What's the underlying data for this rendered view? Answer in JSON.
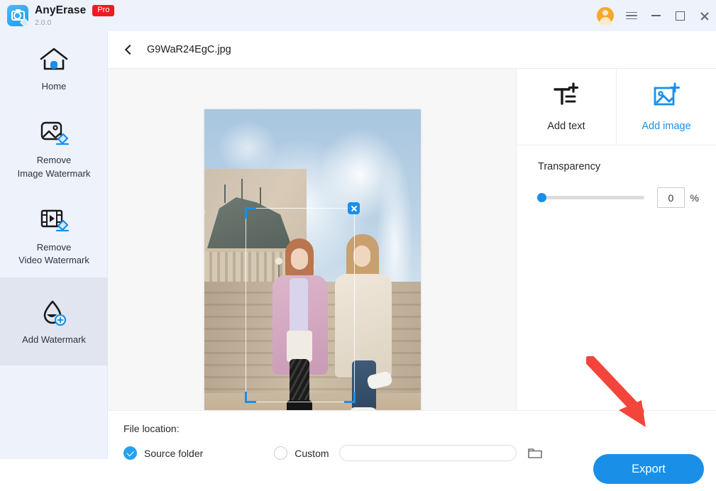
{
  "app": {
    "brand": "AnyErase",
    "badge": "Pro",
    "version": "2.0.0",
    "logo_icon": "camera-eraser-icon"
  },
  "titlebar": {
    "account_icon": "user-avatar-icon",
    "menu_icon": "hamburger-menu-icon",
    "minimize_icon": "minimize-icon",
    "maximize_icon": "maximize-icon",
    "close_icon": "close-icon"
  },
  "sidebar": {
    "items": [
      {
        "label": "Home",
        "icon": "home-icon",
        "active": false
      },
      {
        "label": "Remove\nImage Watermark",
        "line1": "Remove",
        "line2": "Image Watermark",
        "icon": "image-eraser-icon",
        "active": false
      },
      {
        "label": "Remove\nVideo Watermark",
        "line1": "Remove",
        "line2": "Video Watermark",
        "icon": "video-eraser-icon",
        "active": false
      },
      {
        "label": "Add Watermark",
        "line1": "Add Watermark",
        "line2": "",
        "icon": "water-drop-plus-icon",
        "active": true
      }
    ]
  },
  "filebar": {
    "back_icon": "chevron-left-icon",
    "filename": "G9WaR24EgC.jpg"
  },
  "canvas": {
    "image_alt": "two women standing on palace stairs",
    "selection": {
      "delete_icon": "close-icon",
      "handles": [
        "top-left",
        "top-right",
        "bottom-left",
        "bottom-right"
      ]
    }
  },
  "panel": {
    "tabs": [
      {
        "label": "Add text",
        "icon": "add-text-icon",
        "active": false
      },
      {
        "label": "Add image",
        "icon": "add-image-icon",
        "active": true
      }
    ],
    "transparency": {
      "label": "Transparency",
      "value": "0",
      "unit": "%",
      "min": 0,
      "max": 100
    }
  },
  "footer": {
    "file_location_label": "File location:",
    "options": [
      {
        "label": "Source folder",
        "selected": true
      },
      {
        "label": "Custom",
        "selected": false
      }
    ],
    "custom_path_value": "",
    "custom_path_placeholder": "",
    "browse_icon": "folder-icon",
    "export_label": "Export"
  },
  "annotation": {
    "arrow_color": "#f3453c",
    "points_to": "export-button"
  },
  "colors": {
    "accent": "#1a8fe8",
    "sidebar_bg": "#eef2fa",
    "pro_badge": "#ed1c24",
    "avatar": "#f7a82a"
  }
}
